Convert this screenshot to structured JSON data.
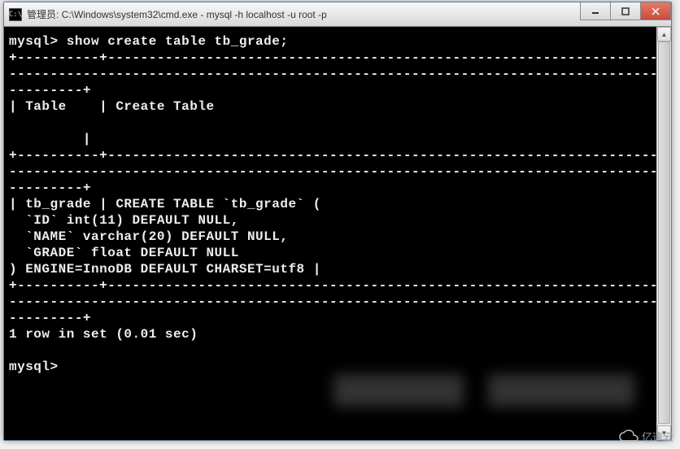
{
  "window": {
    "title": "管理员: C:\\Windows\\system32\\cmd.exe - mysql  -h localhost -u root -p",
    "icon_label": "C:\\"
  },
  "terminal": {
    "prompt": "mysql>",
    "command": "show create table tb_grade;",
    "border_top": "+----------+---------------------------------------------------------------------------------",
    "border_mid": "----------------------------------------------------------------------------------------------",
    "border_end": "---------+",
    "header_row": "| Table    | Create Table",
    "header_pad": "         |",
    "data_row_1": "| tb_grade | CREATE TABLE `tb_grade` (",
    "data_row_2": "  `ID` int(11) DEFAULT NULL,",
    "data_row_3": "  `NAME` varchar(20) DEFAULT NULL,",
    "data_row_4": "  `GRADE` float DEFAULT NULL",
    "data_row_5": ") ENGINE=InnoDB DEFAULT CHARSET=utf8 |",
    "result": "1 row in set (0.01 sec)",
    "blank": ""
  },
  "brand": "亿速云"
}
